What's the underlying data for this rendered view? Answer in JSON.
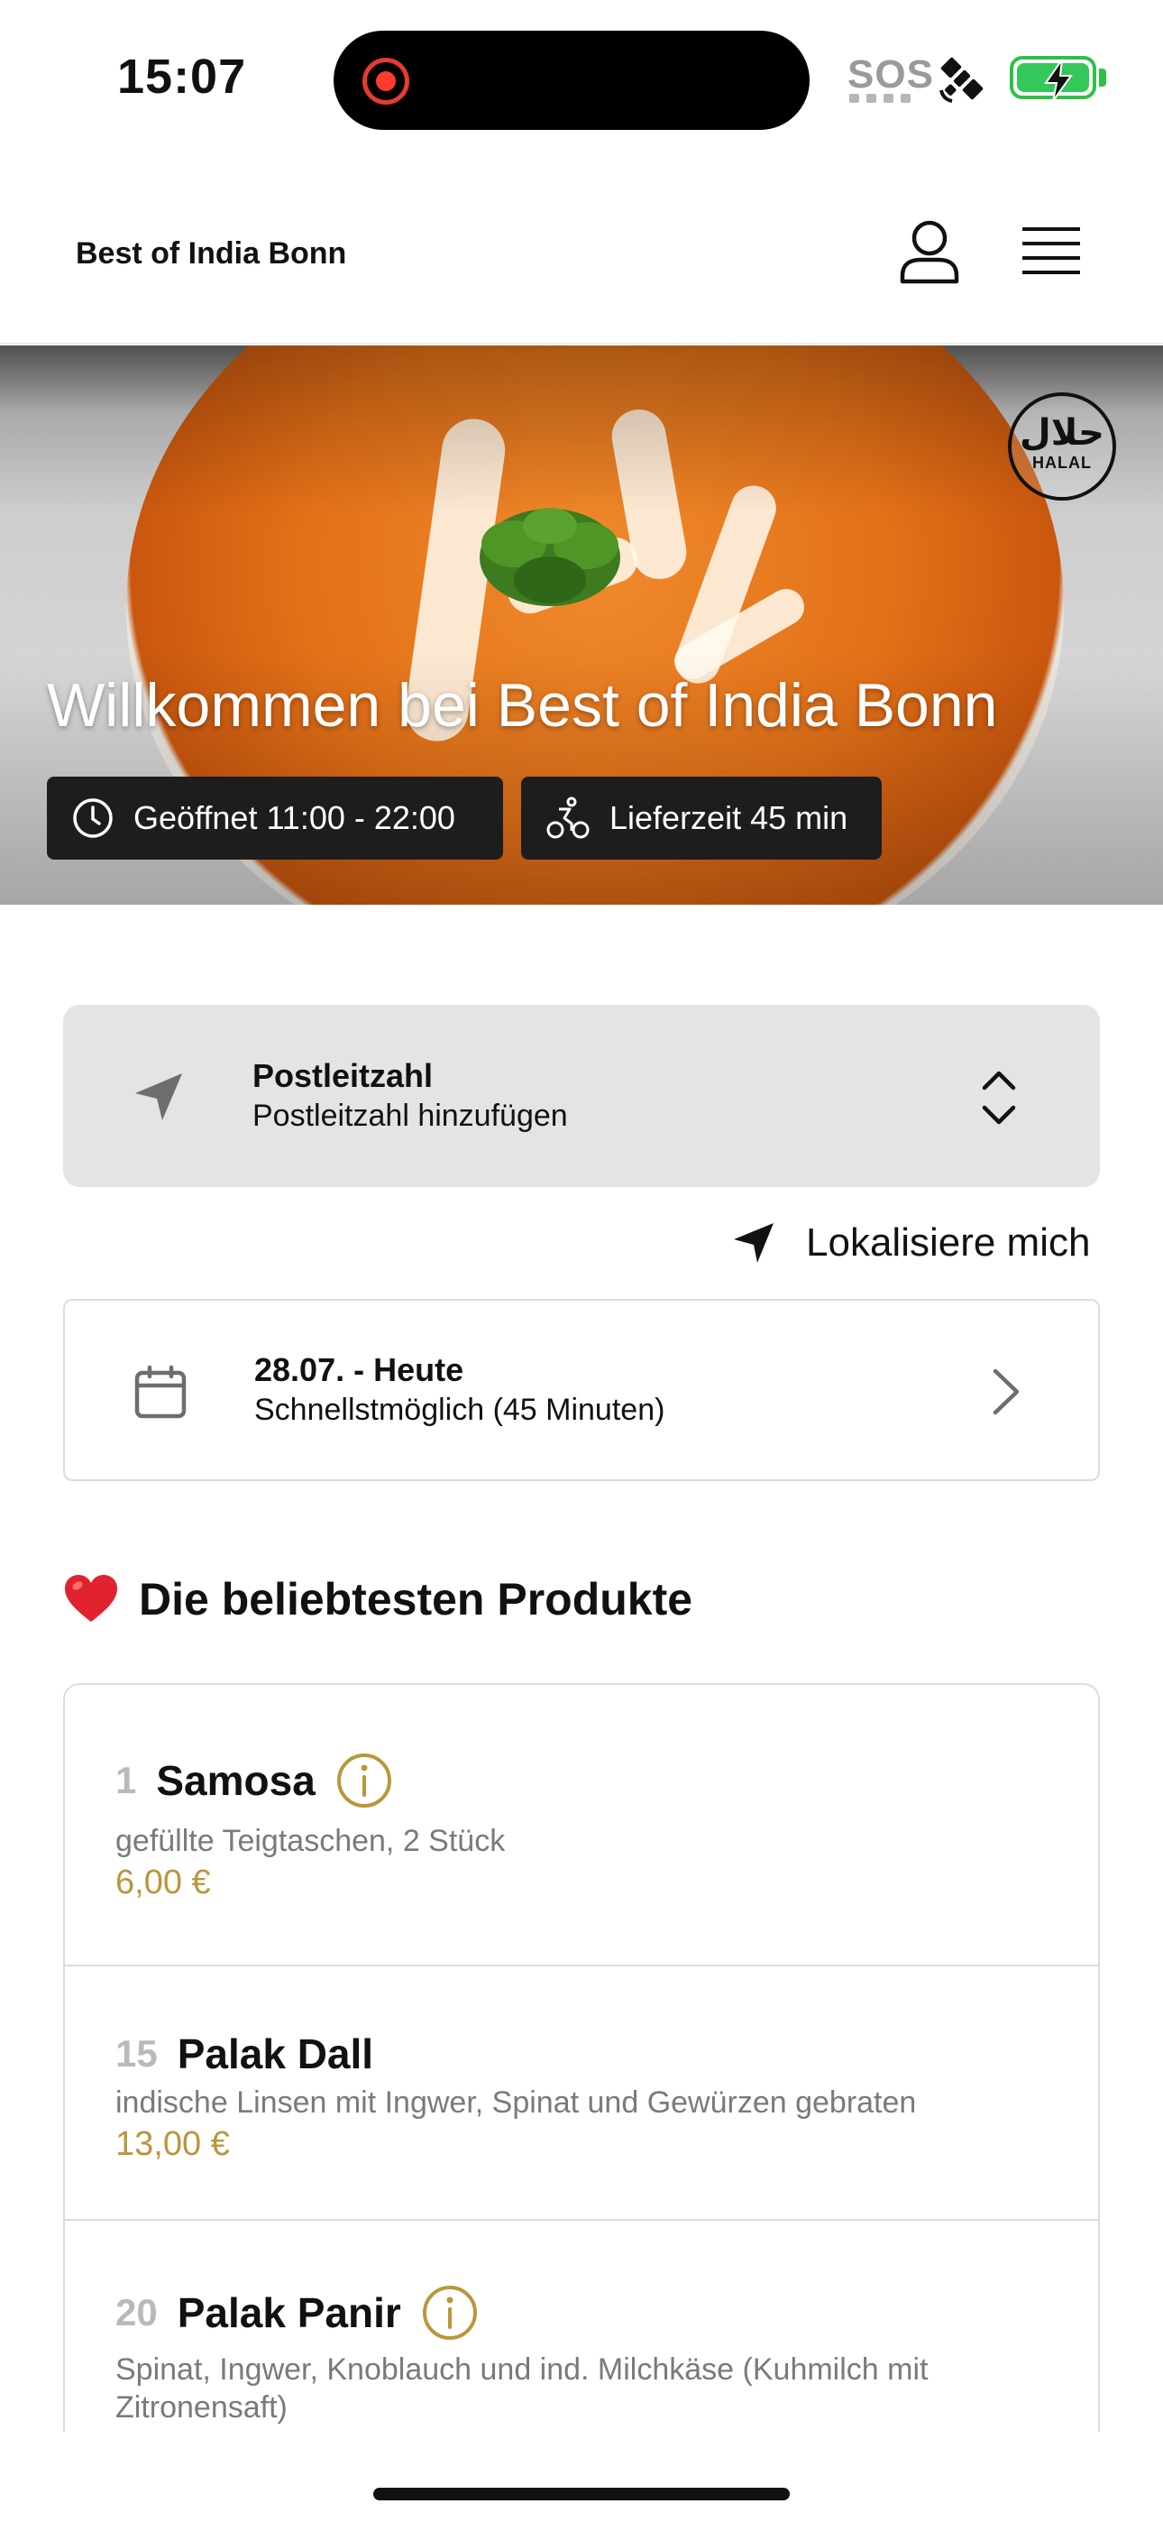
{
  "status_bar": {
    "time": "15:07",
    "sos": "SOS"
  },
  "header": {
    "brand": "Best of India Bonn"
  },
  "hero": {
    "title": "Willkommen bei Best of India Bonn",
    "halal_badge_arabic": "حلال",
    "halal_badge_text": "HALAL",
    "opening_hours": "Geöffnet 11:00 - 22:00",
    "delivery_time": "Lieferzeit 45 min"
  },
  "postcode": {
    "title": "Postleitzahl",
    "subtitle": "Postleitzahl hinzufügen"
  },
  "locate": {
    "label": "Lokalisiere mich"
  },
  "delivery_date": {
    "title": "28.07. - Heute",
    "subtitle": "Schnellstmöglich (45 Minuten)"
  },
  "popular": {
    "heading": "Die beliebtesten Produkte",
    "products": [
      {
        "number": "1",
        "name": "Samosa",
        "description": "gefüllte Teigtaschen, 2 Stück",
        "price": "6,00 €",
        "has_info": true
      },
      {
        "number": "15",
        "name": "Palak Dall",
        "description": "indische Linsen mit Ingwer, Spinat und Gewürzen gebraten",
        "price": "13,00 €",
        "has_info": false
      },
      {
        "number": "20",
        "name": "Palak Panir",
        "description": "Spinat, Ingwer, Knoblauch und ind. Milchkäse (Kuhmilch mit Zitronensaft)",
        "price": "",
        "has_info": true
      }
    ]
  },
  "colors": {
    "accent_gold": "#b9973b",
    "pill_bg": "#1d1d1d",
    "card_bg": "#e4e4e4",
    "battery_green": "#34c759"
  }
}
